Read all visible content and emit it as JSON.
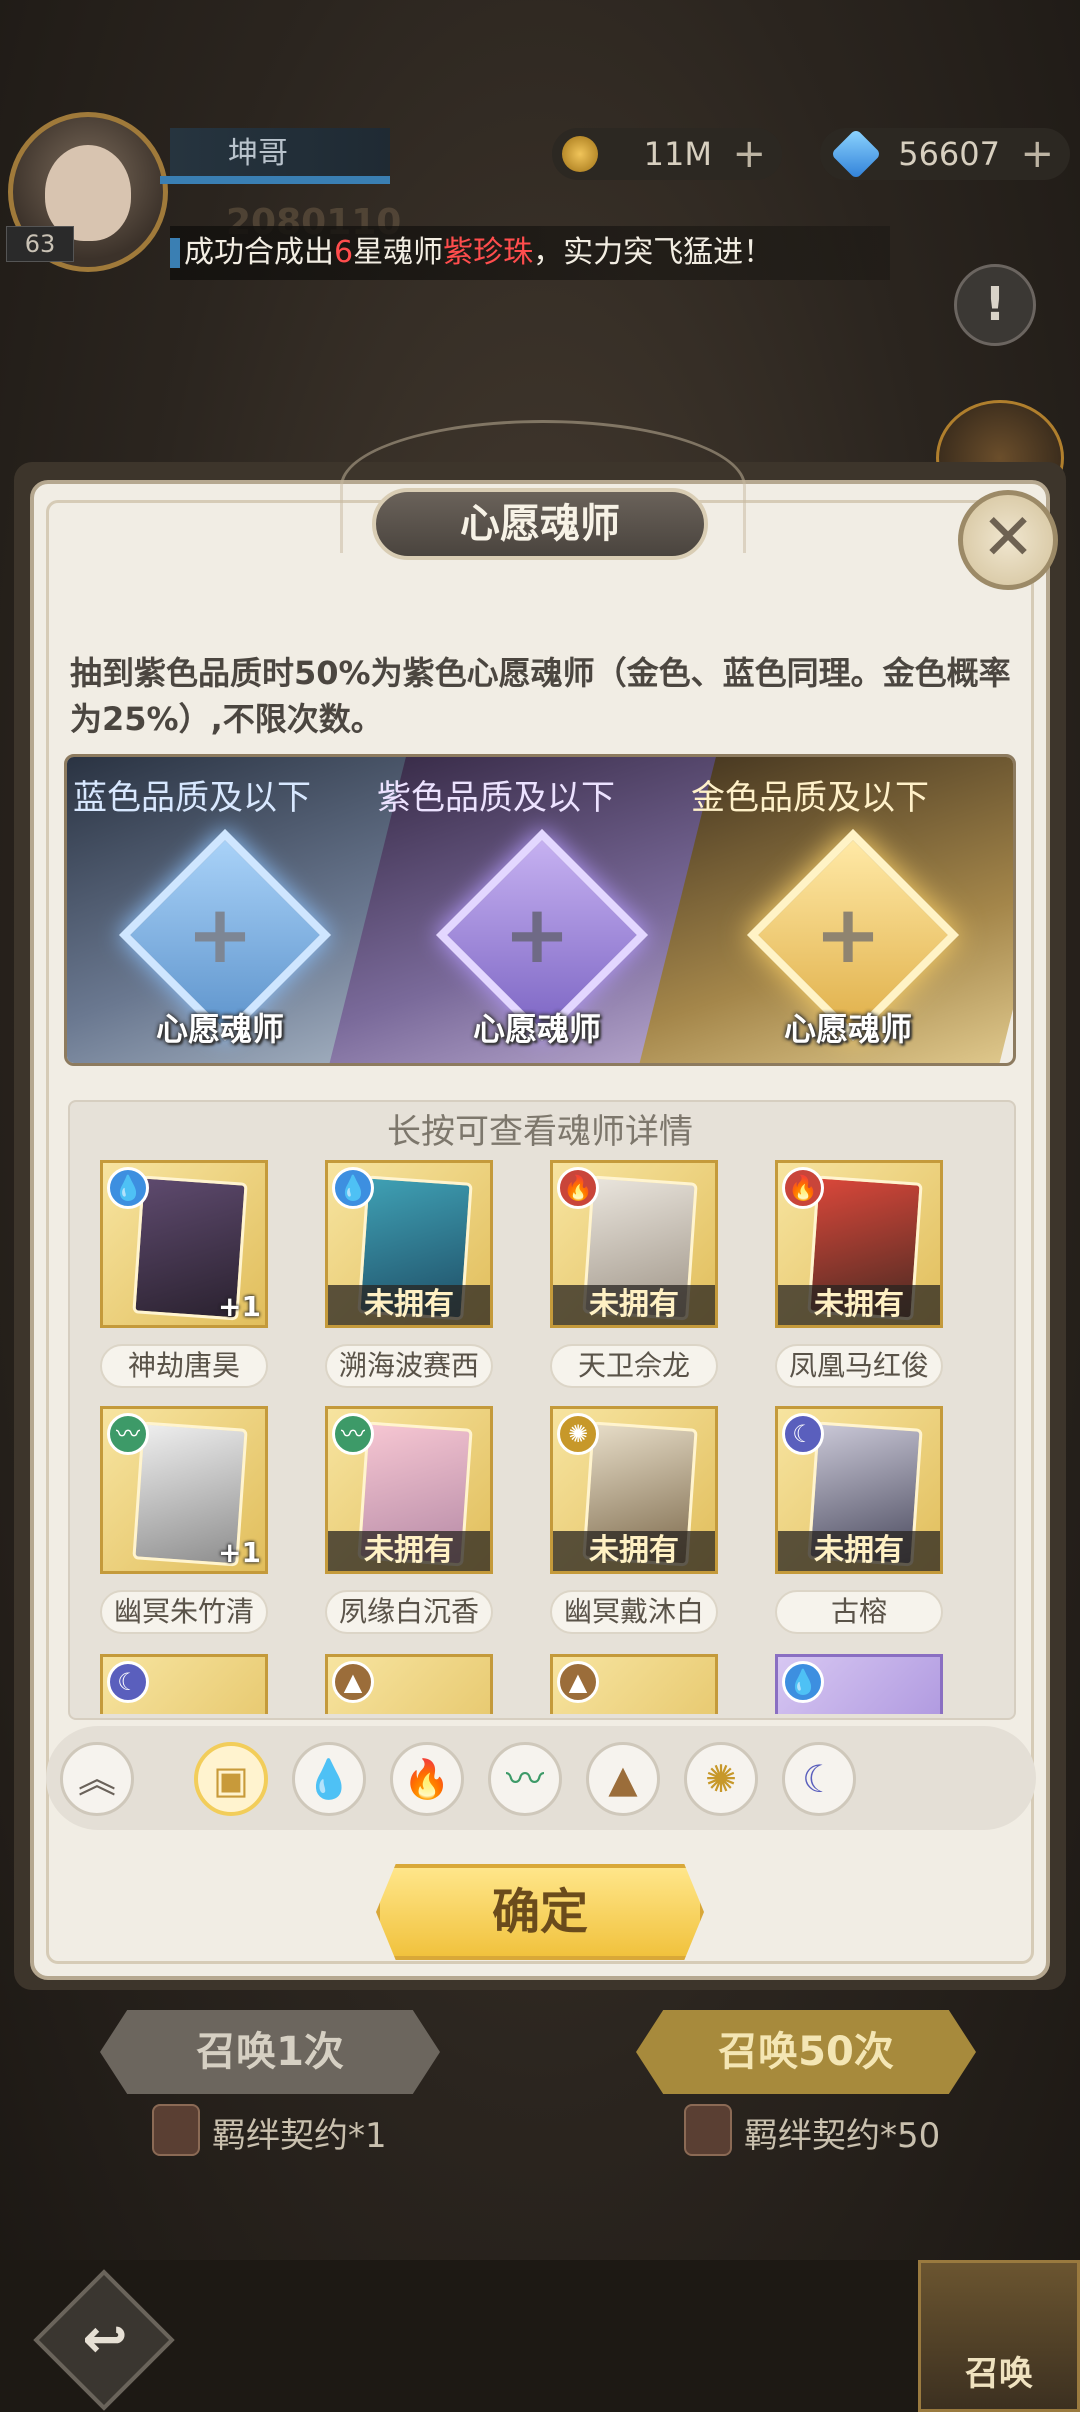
{
  "player": {
    "name": "坤哥",
    "level": "63",
    "power": "2080110"
  },
  "currency": {
    "coins": "11M",
    "gems": "56607"
  },
  "marquee": {
    "prefix": "成功合成出",
    "star": "6",
    "middle": "星魂师",
    "hero": "紫珍珠",
    "suffix": "，实力突飞猛进！"
  },
  "modal": {
    "title": "心愿魂师",
    "description": "抽到紫色品质时50%为紫色心愿魂师（金色、蓝色同理。金色概率为25%）,不限次数。",
    "slots": [
      {
        "label": "蓝色品质及以下",
        "name": "心愿魂师"
      },
      {
        "label": "紫色品质及以下",
        "name": "心愿魂师"
      },
      {
        "label": "金色品质及以下",
        "name": "心愿魂师"
      }
    ],
    "grid_hint": "长按可查看魂师详情",
    "heroes": [
      {
        "name": "神劫唐昊",
        "status": "+1",
        "element": "water-icon"
      },
      {
        "name": "溯海波赛西",
        "status": "未拥有",
        "element": "water-icon"
      },
      {
        "name": "天卫佘龙",
        "status": "未拥有",
        "element": "fire-icon"
      },
      {
        "name": "凤凰马红俊",
        "status": "未拥有",
        "element": "fire-icon"
      },
      {
        "name": "幽冥朱竹清",
        "status": "+1",
        "element": "wind-icon"
      },
      {
        "name": "夙缘白沉香",
        "status": "未拥有",
        "element": "wind-icon"
      },
      {
        "name": "幽冥戴沐白",
        "status": "未拥有",
        "element": "light-icon"
      },
      {
        "name": "古榕",
        "status": "未拥有",
        "element": "dark-icon"
      }
    ],
    "confirm_label": "确定"
  },
  "background": {
    "summon_1": "召唤1次",
    "summon_50": "召唤50次",
    "contract_1": "羁绊契约*1",
    "contract_50": "羁绊契约*50",
    "bottom_summon": "召唤"
  },
  "icons": {
    "alert": "!",
    "close": "✕",
    "plus": "+"
  }
}
